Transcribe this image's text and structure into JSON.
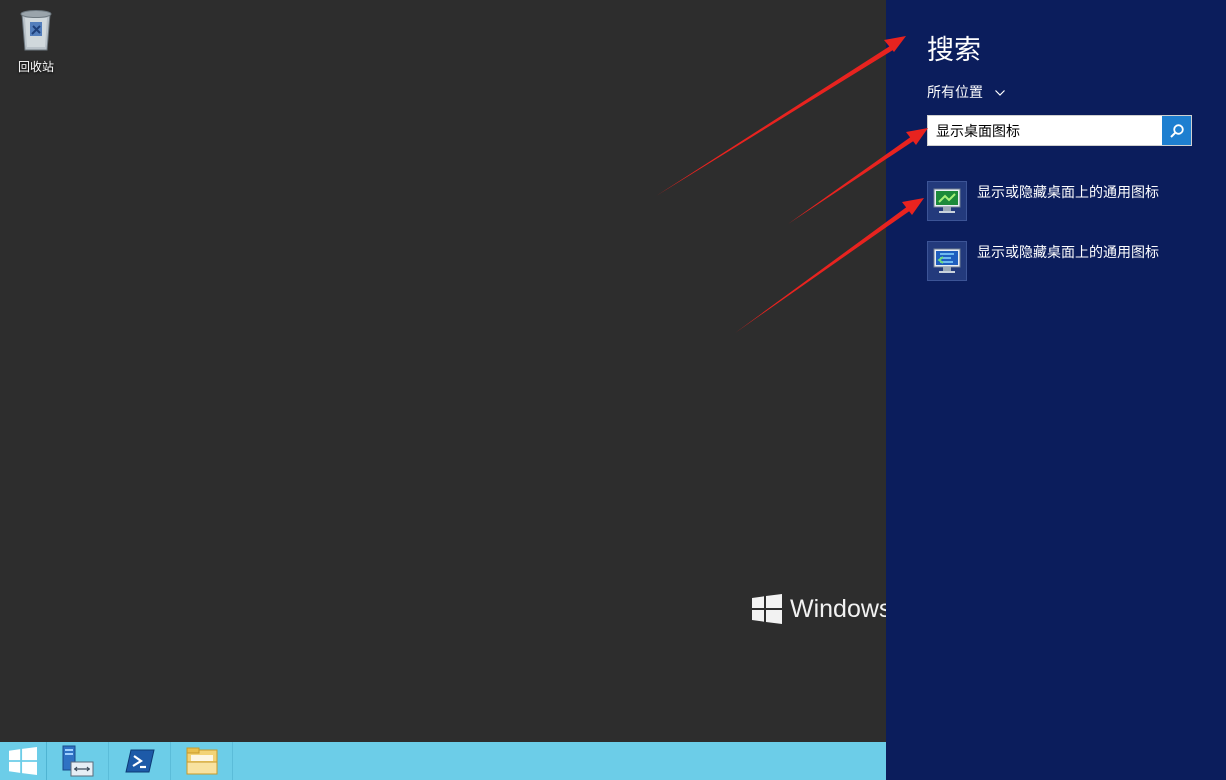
{
  "desktop": {
    "recycle_bin_label": "回收站",
    "watermark_text": "Windows"
  },
  "search_pane": {
    "title": "搜索",
    "scope_label": "所有位置",
    "query_value": "显示桌面图标",
    "results": [
      {
        "label": "显示或隐藏桌面上的通用图标"
      },
      {
        "label": "显示或隐藏桌面上的通用图标"
      }
    ]
  },
  "colors": {
    "desktop_bg": "#2d2d2d",
    "charm_bg": "#0b1d5c",
    "taskbar_bg": "#6ccde8",
    "search_button": "#1e7fd0",
    "arrow": "#e8231f"
  },
  "icons": {
    "recycle_bin": "recycle-bin-icon",
    "start": "windows-logo-icon",
    "server_manager": "server-manager-icon",
    "powershell": "powershell-icon",
    "file_explorer": "folder-icon",
    "search": "search-icon",
    "scope_dropdown": "chevron-down-icon",
    "result": "monitor-icon"
  }
}
